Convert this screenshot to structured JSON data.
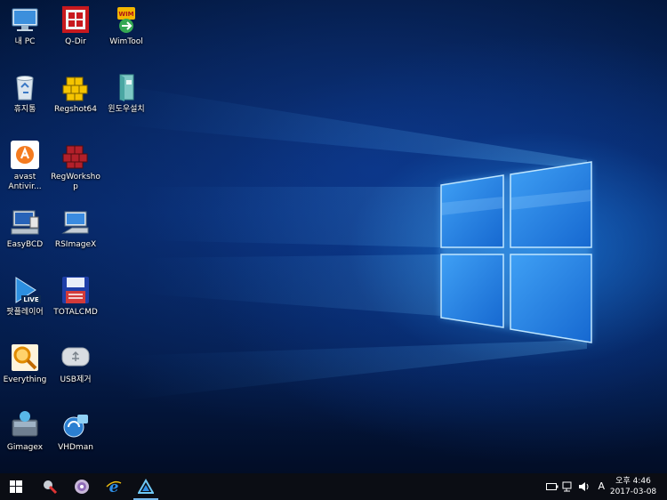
{
  "desktop": {
    "icons": [
      {
        "label": "내 PC",
        "icon": "this-pc-icon"
      },
      {
        "label": "Q-Dir",
        "icon": "q-dir-icon"
      },
      {
        "label": "WimTool",
        "icon": "wimtool-icon",
        "badge": "WIM"
      },
      {
        "label": "휴지통",
        "icon": "recycle-bin-icon"
      },
      {
        "label": "Regshot64",
        "icon": "regshot-icon"
      },
      {
        "label": "윈도우설치",
        "icon": "windows-setup-icon"
      },
      {
        "label": "avast Antivir...",
        "icon": "avast-icon"
      },
      {
        "label": "RegWorkshop",
        "icon": "regworkshop-icon"
      },
      {
        "label": "EasyBCD",
        "icon": "easybcd-icon"
      },
      {
        "label": "RSImageX",
        "icon": "rsimagex-icon"
      },
      {
        "label": "팟플레이어",
        "icon": "potplayer-icon",
        "badge": "LIVE"
      },
      {
        "label": "TOTALCMD",
        "icon": "totalcmd-icon"
      },
      {
        "label": "Everything",
        "icon": "everything-icon"
      },
      {
        "label": "USB제거",
        "icon": "usb-eject-icon"
      },
      {
        "label": "Gimagex",
        "icon": "gimagex-icon"
      },
      {
        "label": "VHDman",
        "icon": "vhdman-icon"
      }
    ]
  },
  "taskbar": {
    "items": [
      {
        "name": "start-button",
        "icon": "windows-logo-icon"
      },
      {
        "name": "taskbar-app-1",
        "icon": "tools-icon"
      },
      {
        "name": "taskbar-app-2",
        "icon": "disc-icon"
      },
      {
        "name": "taskbar-app-3",
        "icon": "internet-explorer-icon"
      },
      {
        "name": "taskbar-app-4",
        "icon": "triangle-app-icon",
        "active": true
      }
    ],
    "tray": {
      "ime": "A",
      "time": "오후 4:46",
      "date": "2017-03-08"
    }
  },
  "colors": {
    "accent": "#76b9ed",
    "taskbar": "#0b0d14",
    "wallpaper_glow": "#1e82e6"
  }
}
